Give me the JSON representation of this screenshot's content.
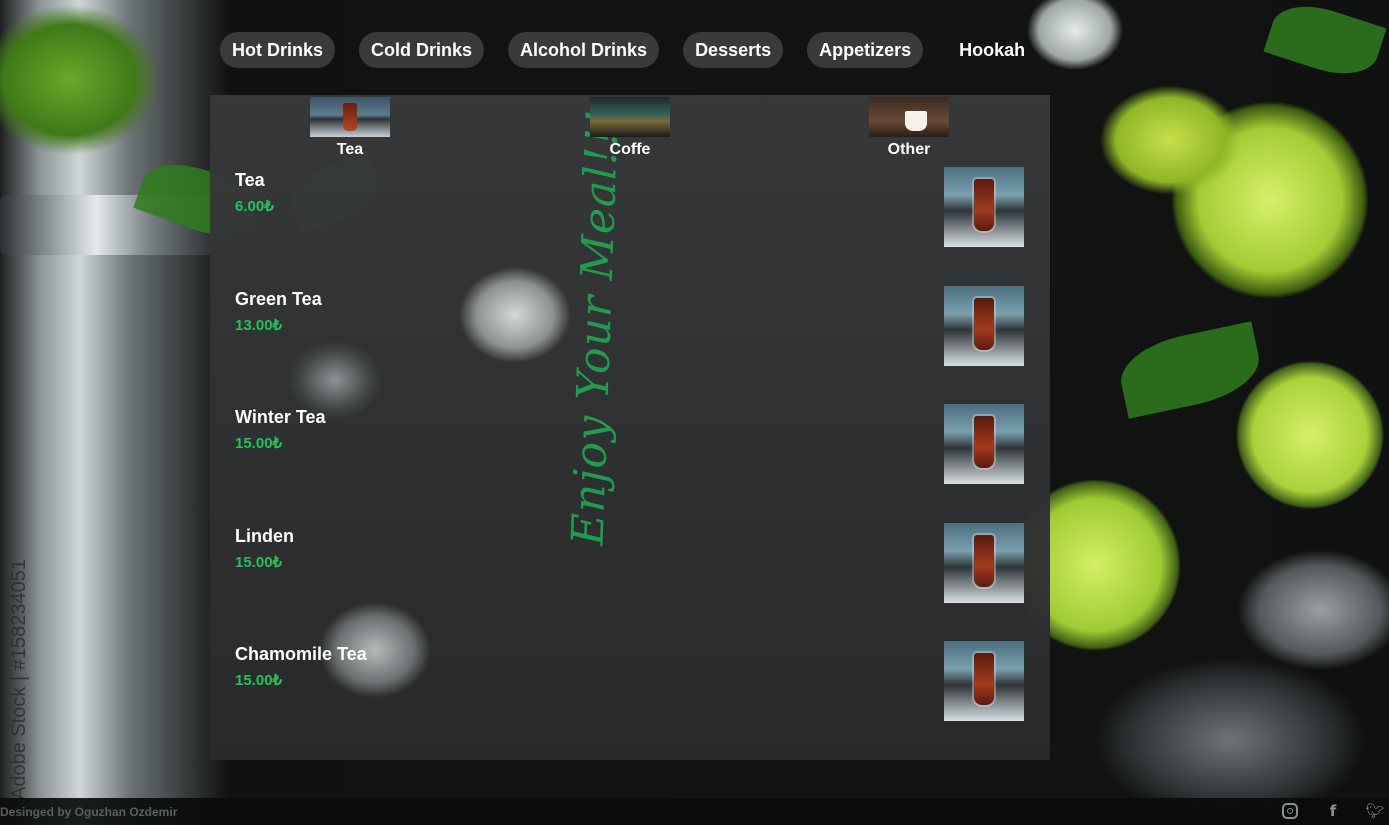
{
  "nav": {
    "items": [
      {
        "label": "Hot Drinks"
      },
      {
        "label": "Cold Drinks"
      },
      {
        "label": "Alcohol Drinks"
      },
      {
        "label": "Desserts"
      },
      {
        "label": "Appetizers"
      },
      {
        "label": "Hookah"
      }
    ]
  },
  "subcategories": [
    {
      "label": "Tea"
    },
    {
      "label": "Coffe"
    },
    {
      "label": "Other"
    }
  ],
  "menu_items": [
    {
      "name": "Tea",
      "price": "6.00₺"
    },
    {
      "name": "Green Tea",
      "price": "13.00₺"
    },
    {
      "name": "Winter Tea",
      "price": "15.00₺"
    },
    {
      "name": "Linden",
      "price": "15.00₺"
    },
    {
      "name": "Chamomile Tea",
      "price": "15.00₺"
    }
  ],
  "decor": {
    "slogan": "Enjoy Your Meal!!!",
    "watermark": "Adobe Stock | #158234051"
  },
  "footer": {
    "credit": "Desinged by Oguzhan Ozdemir",
    "social": [
      "instagram-icon",
      "facebook-icon",
      "twitter-icon"
    ]
  },
  "colors": {
    "accent_price": "#21c35a",
    "slogan": "#1f9d4e",
    "nav_pill": "#46484a"
  }
}
